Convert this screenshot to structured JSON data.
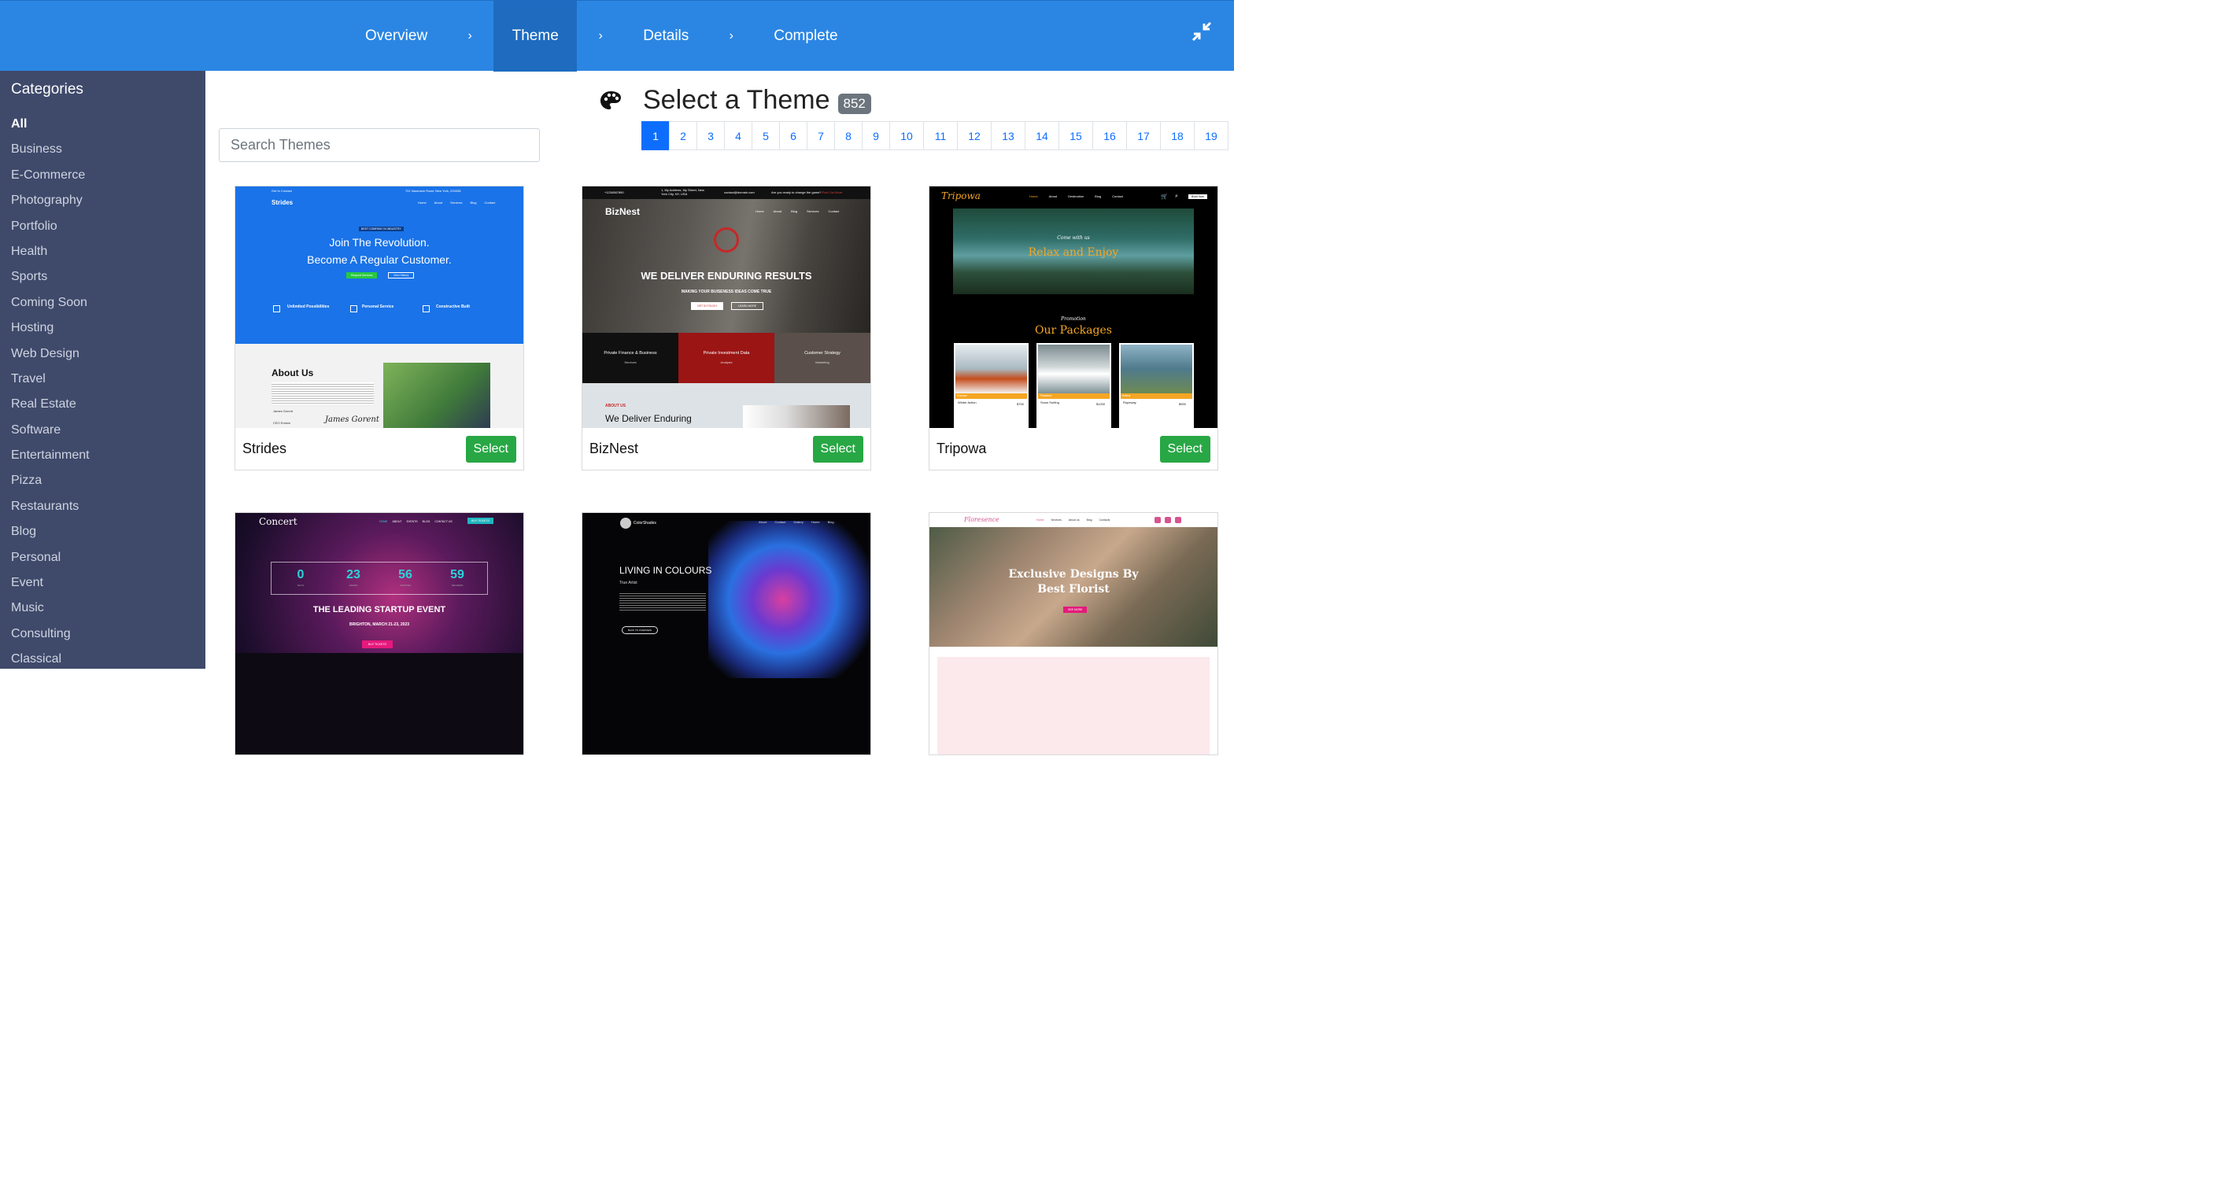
{
  "wizard": {
    "steps": [
      {
        "label": "Overview",
        "active": false
      },
      {
        "label": "Theme",
        "active": true
      },
      {
        "label": "Details",
        "active": false
      },
      {
        "label": "Complete",
        "active": false
      }
    ],
    "separator": "›",
    "collapse_icon": "compress-arrows-icon"
  },
  "sidebar": {
    "title": "Categories",
    "items": [
      "All",
      "Business",
      "E-Commerce",
      "Photography",
      "Portfolio",
      "Health",
      "Sports",
      "Coming Soon",
      "Hosting",
      "Web Design",
      "Travel",
      "Real Estate",
      "Software",
      "Entertainment",
      "Pizza",
      "Restaurants",
      "Blog",
      "Personal",
      "Event",
      "Music",
      "Consulting",
      "Classical"
    ],
    "active": "All"
  },
  "search": {
    "placeholder": "Search Themes",
    "value": ""
  },
  "header": {
    "icon": "palette-icon",
    "title": "Select a Theme",
    "count": "852"
  },
  "pagination": {
    "pages": [
      "1",
      "2",
      "3",
      "4",
      "5",
      "6",
      "7",
      "8",
      "9",
      "10",
      "11",
      "12",
      "13",
      "14",
      "15",
      "16",
      "17",
      "18",
      "19"
    ],
    "active": "1"
  },
  "select_label": "Select",
  "themes": [
    {
      "name": "Strides",
      "preview": {
        "topbar": "Get In Contact",
        "address": "701 Naumann Road, New York, 200038",
        "brand": "Strides",
        "nav": [
          "Home",
          "About",
          "Services",
          "Blog",
          "Contact"
        ],
        "kicker": "BEST COMPANY IN INDUSTRY",
        "headline1": "Join The Revolution.",
        "headline2": "Become A Regular Customer.",
        "btn1": "Request Services",
        "btn2": "View History",
        "features": [
          "Unlimited Possibilities",
          "Personal Service",
          "Constructive Built"
        ],
        "about_title": "About Us",
        "signature": "James Gorent",
        "signer": "James Gorent",
        "signer_role": "CEO Endow"
      }
    },
    {
      "name": "BizNest",
      "preview": {
        "phone": "+1234567890",
        "address": "1, My Address, My Street, New York City, NY, USA",
        "email": "contact@domain.com",
        "cta_text": "Are you ready to change the game?",
        "cta_link": "Find Out More",
        "brand": "BizNest",
        "nav": [
          "Home",
          "About",
          "Blog",
          "Services",
          "Contact"
        ],
        "headline": "WE DELIVER  ENDURING RESULTS",
        "sub": "MAKING YOUR BUISENESS  IDEAS COME TRUE",
        "btn1": "GET IN TOUCH",
        "btn2": "LEARN MORE",
        "tiles": [
          {
            "title": "Private Finance & Business",
            "sub": "Services",
            "color": "#101010"
          },
          {
            "title": "Private Investment Data",
            "sub": "Analysis",
            "color": "#9b1515"
          },
          {
            "title": "Customer Strategy",
            "sub": "Marketing",
            "color": "#5a4f4a"
          }
        ],
        "about_kicker": "ABOUT US",
        "about_title": "We Deliver Enduring"
      }
    },
    {
      "name": "Tripowa",
      "preview": {
        "brand": "Tripowa",
        "nav": [
          "Home",
          "About",
          "Destination",
          "Blog",
          "Contact"
        ],
        "book": "Book Now",
        "kicker": "Come with us",
        "headline": "Relax and Enjoy",
        "promo": "Promotion",
        "packages_title": "Our Packages",
        "packages": [
          {
            "region": "Europe",
            "name": "Winter Action",
            "price": "$700"
          },
          {
            "region": "Thailand",
            "name": "Snow Surfing",
            "price": "$1200"
          },
          {
            "region": "Africa",
            "name": "Ropeway",
            "price": "$900"
          }
        ]
      }
    },
    {
      "name": "Concert",
      "preview": {
        "brand": "Concert",
        "nav": [
          "HOME",
          "ABOUT",
          "EVENTS",
          "BLOG",
          "CONTACT US"
        ],
        "tickets": "BUY TICKETS",
        "countdown": [
          {
            "value": "0",
            "unit": "DAYS"
          },
          {
            "value": "23",
            "unit": "HOURS"
          },
          {
            "value": "56",
            "unit": "MINUTES"
          },
          {
            "value": "59",
            "unit": "SECONDS"
          }
        ],
        "headline": "THE LEADING STARTUP EVENT",
        "sub": "BRIGHTON, MARCH 21-23, 2023",
        "btn": "BUY TICKETS"
      }
    },
    {
      "name": "ColorShades",
      "preview": {
        "brand": "ColorShades",
        "nav": [
          "About",
          "Contact",
          "Gallery",
          "Home",
          "Blog"
        ],
        "headline": "LIVING IN COLOURS",
        "sub": "True Artist",
        "btn": "BACK TO OVERVIEW"
      }
    },
    {
      "name": "Floresence",
      "preview": {
        "brand": "Floresence",
        "nav": [
          "Home",
          "Services",
          "About us",
          "Blog",
          "Contacts"
        ],
        "headline1": "Exclusive Designs By",
        "headline2": "Best Florist",
        "btn": "SEE MORE"
      }
    }
  ],
  "colors": {
    "topbar": "#2b86e3",
    "active_step": "#1e6bbf",
    "sidebar": "#3f4a6b",
    "select": "#28a745",
    "page_active": "#0d6efd"
  }
}
